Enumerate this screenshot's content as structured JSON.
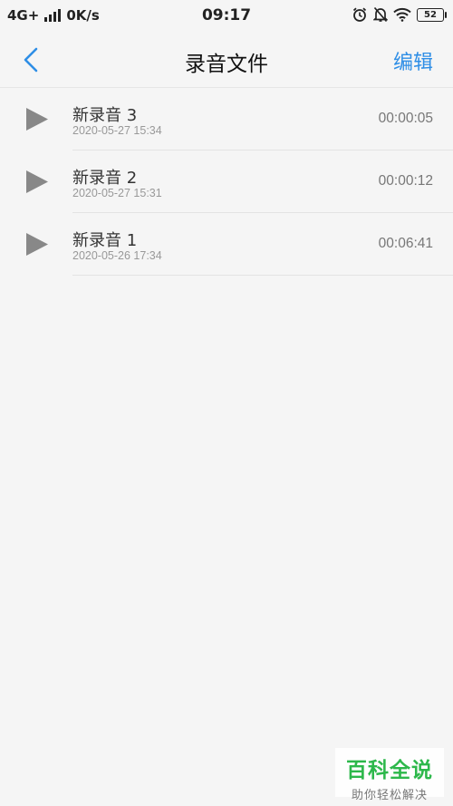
{
  "status_bar": {
    "network": "4G+",
    "speed": "0K/s",
    "time": "09:17",
    "battery": "52"
  },
  "nav": {
    "title": "录音文件",
    "edit_label": "编辑"
  },
  "recordings": [
    {
      "name": "新录音 3",
      "date": "2020-05-27 15:34",
      "duration": "00:00:05"
    },
    {
      "name": "新录音 2",
      "date": "2020-05-27 15:31",
      "duration": "00:00:12"
    },
    {
      "name": "新录音 1",
      "date": "2020-05-26 17:34",
      "duration": "00:06:41"
    }
  ],
  "watermark": {
    "main": "百科全说",
    "sub": "助你轻松解决"
  },
  "colors": {
    "accent": "#2e8ee6",
    "background": "#f5f5f5",
    "play_icon": "#888888",
    "watermark_green": "#2db84b"
  }
}
